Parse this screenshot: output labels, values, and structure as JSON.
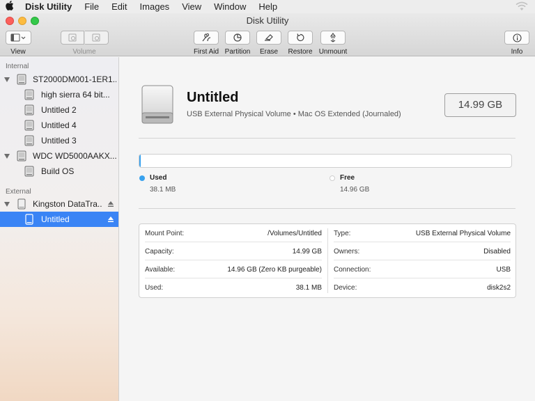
{
  "menubar": {
    "app_name": "Disk Utility",
    "items": [
      "File",
      "Edit",
      "Images",
      "View",
      "Window",
      "Help"
    ]
  },
  "window": {
    "title": "Disk Utility"
  },
  "toolbar": {
    "view": "View",
    "volume": "Volume",
    "first_aid": "First Aid",
    "partition": "Partition",
    "erase": "Erase",
    "restore": "Restore",
    "unmount": "Unmount",
    "info": "Info"
  },
  "sidebar": {
    "internal_header": "Internal",
    "external_header": "External",
    "rows": [
      {
        "label": "ST2000DM001-1ER1..."
      },
      {
        "label": "high sierra 64 bit..."
      },
      {
        "label": "Untitled 2"
      },
      {
        "label": "Untitled 4"
      },
      {
        "label": "Untitled 3"
      },
      {
        "label": "WDC WD5000AAKX..."
      },
      {
        "label": "Build OS"
      },
      {
        "label": "Kingston DataTra..."
      },
      {
        "label": "Untitled"
      }
    ]
  },
  "volume": {
    "name": "Untitled",
    "description": "USB External Physical Volume • Mac OS Extended (Journaled)",
    "size": "14.99 GB"
  },
  "usage": {
    "used_fraction": 0.0025,
    "used_label": "Used",
    "used_value": "38.1 MB",
    "free_label": "Free",
    "free_value": "14.96 GB"
  },
  "info": {
    "left": [
      {
        "key": "Mount Point:",
        "value": "/Volumes/Untitled"
      },
      {
        "key": "Capacity:",
        "value": "14.99 GB"
      },
      {
        "key": "Available:",
        "value": "14.96 GB (Zero KB purgeable)"
      },
      {
        "key": "Used:",
        "value": "38.1 MB"
      }
    ],
    "right": [
      {
        "key": "Type:",
        "value": "USB External Physical Volume"
      },
      {
        "key": "Owners:",
        "value": "Disabled"
      },
      {
        "key": "Connection:",
        "value": "USB"
      },
      {
        "key": "Device:",
        "value": "disk2s2"
      }
    ]
  },
  "colors": {
    "used": "#39a2ee",
    "free": "#ffffff",
    "selection": "#3a84f5",
    "close": "#fc605c",
    "minimize": "#fdbc40",
    "zoom": "#34c84a"
  },
  "icons": [
    "apple-icon",
    "wifi-icon",
    "sidebar-toggle-icon",
    "first-aid-icon",
    "partition-icon",
    "erase-icon",
    "restore-icon",
    "unmount-icon",
    "info-icon",
    "disk-icon",
    "eject-icon"
  ]
}
